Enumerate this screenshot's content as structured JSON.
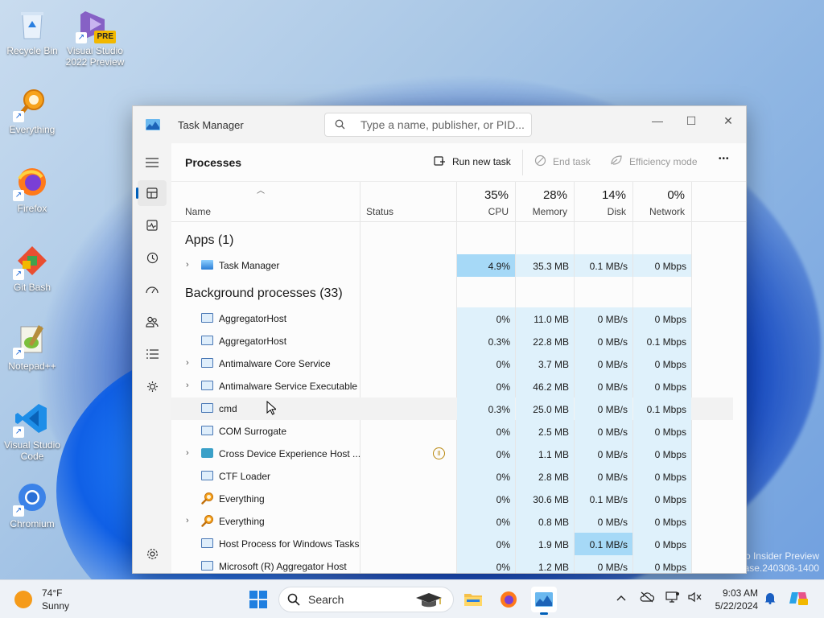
{
  "desktop": {
    "icons": [
      {
        "label_line1": "Recycle Bin",
        "label_line2": ""
      },
      {
        "label_line1": "Visual Studio",
        "label_line2": "2022 Preview"
      },
      {
        "label_line1": "Everything",
        "label_line2": ""
      },
      {
        "label_line1": "Firefox",
        "label_line2": ""
      },
      {
        "label_line1": "Git Bash",
        "label_line2": ""
      },
      {
        "label_line1": "Notepad++",
        "label_line2": ""
      },
      {
        "label_line1": "Visual Studio",
        "label_line2": "Code"
      },
      {
        "label_line1": "Chromium",
        "label_line2": ""
      }
    ],
    "vs_badge": "PRE",
    "watermark_line1": "o Insider Preview",
    "watermark_line2": "ease.240308-1400"
  },
  "window": {
    "title": "Task Manager",
    "search_placeholder": "Type a name, publisher, or PID...",
    "controls": {
      "minimize": "—",
      "maximize": "☐",
      "close": "✕"
    }
  },
  "nav": {
    "items": [
      "hamburger-icon",
      "processes-icon",
      "performance-icon",
      "app-history-icon",
      "startup-apps-icon",
      "users-icon",
      "details-icon",
      "services-icon",
      "settings-icon"
    ]
  },
  "commandbar": {
    "page_title": "Processes",
    "run_new_task": "Run new task",
    "end_task": "End task",
    "efficiency_mode": "Efficiency mode",
    "more": "•••"
  },
  "columns": {
    "name": "Name",
    "status": "Status",
    "cpu_pct": "35%",
    "cpu": "CPU",
    "mem_pct": "28%",
    "mem": "Memory",
    "disk_pct": "14%",
    "disk": "Disk",
    "net_pct": "0%",
    "net": "Network"
  },
  "groups": {
    "apps": "Apps (1)",
    "background": "Background processes (33)"
  },
  "apps": [
    {
      "name": "Task Manager",
      "cpu": "4.9%",
      "mem": "35.3 MB",
      "disk": "0.1 MB/s",
      "net": "0 Mbps"
    }
  ],
  "processes": [
    {
      "name": "AggregatorHost",
      "cpu": "0%",
      "mem": "11.0 MB",
      "disk": "0 MB/s",
      "net": "0 Mbps"
    },
    {
      "name": "AggregatorHost",
      "cpu": "0.3%",
      "mem": "22.8 MB",
      "disk": "0 MB/s",
      "net": "0.1 Mbps"
    },
    {
      "name": "Antimalware Core Service",
      "cpu": "0%",
      "mem": "3.7 MB",
      "disk": "0 MB/s",
      "net": "0 Mbps"
    },
    {
      "name": "Antimalware Service Executable",
      "cpu": "0%",
      "mem": "46.2 MB",
      "disk": "0 MB/s",
      "net": "0 Mbps"
    },
    {
      "name": "cmd",
      "cpu": "0.3%",
      "mem": "25.0 MB",
      "disk": "0 MB/s",
      "net": "0.1 Mbps"
    },
    {
      "name": "COM Surrogate",
      "cpu": "0%",
      "mem": "2.5 MB",
      "disk": "0 MB/s",
      "net": "0 Mbps"
    },
    {
      "name": "Cross Device Experience Host ...",
      "cpu": "0%",
      "mem": "1.1 MB",
      "disk": "0 MB/s",
      "net": "0 Mbps"
    },
    {
      "name": "CTF Loader",
      "cpu": "0%",
      "mem": "2.8 MB",
      "disk": "0 MB/s",
      "net": "0 Mbps"
    },
    {
      "name": "Everything",
      "cpu": "0%",
      "mem": "30.6 MB",
      "disk": "0.1 MB/s",
      "net": "0 Mbps"
    },
    {
      "name": "Everything",
      "cpu": "0%",
      "mem": "0.8 MB",
      "disk": "0 MB/s",
      "net": "0 Mbps"
    },
    {
      "name": "Host Process for Windows Tasks",
      "cpu": "0%",
      "mem": "1.9 MB",
      "disk": "0.1 MB/s",
      "net": "0 Mbps"
    },
    {
      "name": "Microsoft (R) Aggregator Host",
      "cpu": "0%",
      "mem": "1.2 MB",
      "disk": "0 MB/s",
      "net": "0 Mbps"
    }
  ],
  "taskbar": {
    "temp": "74°F",
    "condition": "Sunny",
    "search_label": "Search",
    "time": "9:03 AM",
    "date": "5/22/2024"
  }
}
